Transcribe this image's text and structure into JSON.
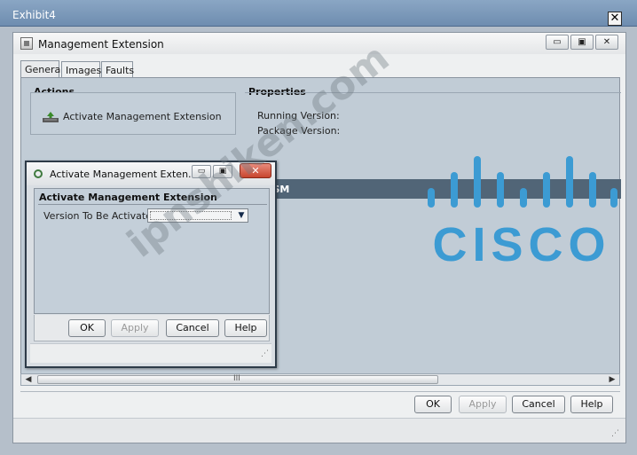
{
  "exhibit": {
    "title": "Exhibit4",
    "close_glyph": "✕"
  },
  "main_window": {
    "title": "Management Extension",
    "window_buttons": [
      "▭",
      "▣",
      "✕"
    ],
    "tabs": [
      {
        "label": "General",
        "active": true
      },
      {
        "label": "Images",
        "active": false
      },
      {
        "label": "Faults",
        "active": false
      }
    ],
    "actions": {
      "title": "Actions",
      "items": [
        {
          "label": "Activate Management Extension",
          "icon": "activate-extension-icon"
        }
      ]
    },
    "properties": {
      "title": "Properties",
      "running_version_label": "Running Version:",
      "package_version_label": "Package Version:",
      "fsm_label": "FSM"
    },
    "scrollbar_grip": "III",
    "buttons": {
      "ok": "OK",
      "apply": "Apply",
      "cancel": "Cancel",
      "help": "Help"
    }
  },
  "dialog": {
    "title": "Activate Management Exten...",
    "window_buttons": [
      "▭",
      "▣"
    ],
    "close_glyph": "✕",
    "section_title": "Activate Management Extension",
    "field_label": "Version To Be Activated:",
    "field_value": "",
    "buttons": {
      "ok": "OK",
      "apply": "Apply",
      "cancel": "Cancel",
      "help": "Help"
    }
  },
  "watermark": "ipnshiken.com",
  "logo": {
    "name": "cisco-logo",
    "color": "#3c9bd3"
  },
  "colors": {
    "exhibit_bar": "#7493b6",
    "panel": "#c1ccd6",
    "fsm_bar": "#516577",
    "dialog_close": "#c7452e"
  }
}
